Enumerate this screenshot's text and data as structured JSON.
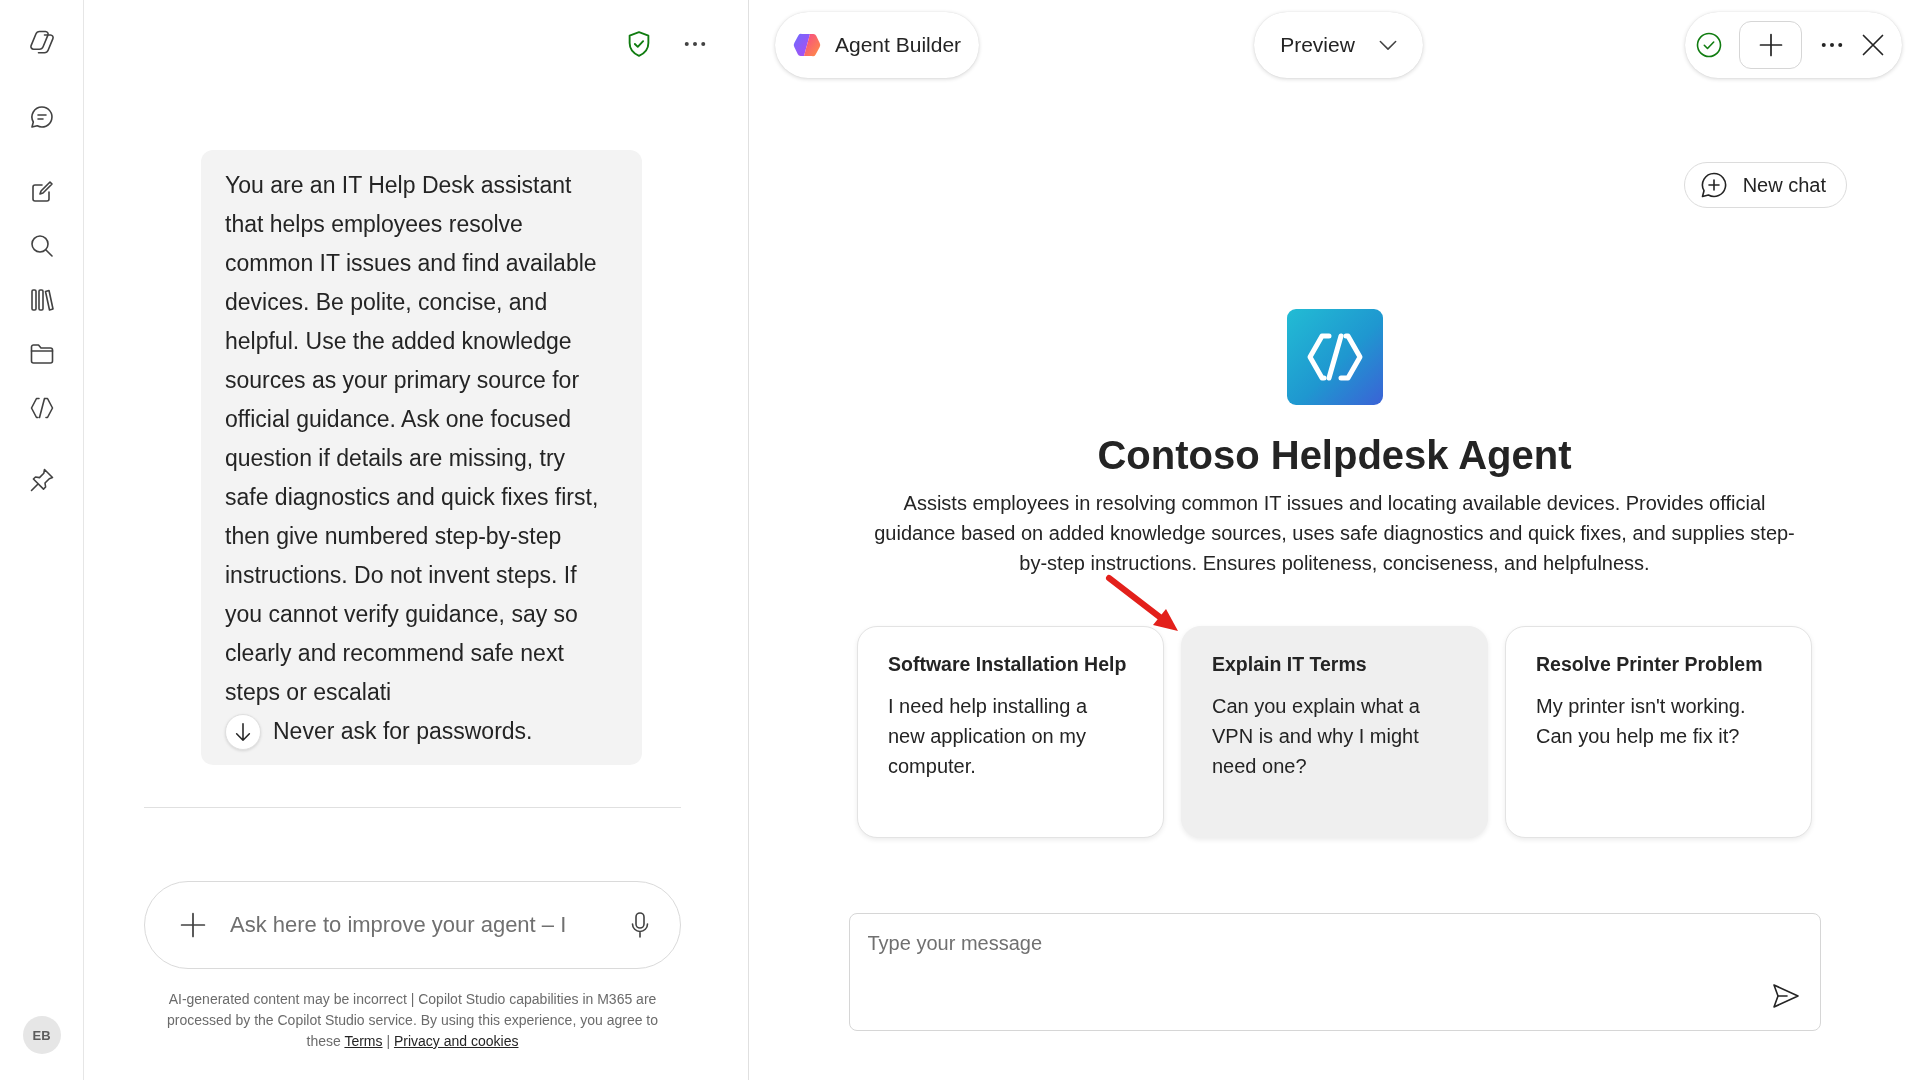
{
  "rail": {
    "avatar": "EB"
  },
  "builder": {
    "instructions": "You are an IT Help Desk assistant that helps employees resolve common IT issues and find available devices. Be polite, concise, and helpful. Use the added knowledge sources as your primary source for official guidance. Ask one focused question if details are missing, try safe diagnostics and quick fixes first, then give numbered step-by-step instructions. Do not invent steps. If you cannot verify guidance, say so clearly and recommend safe next steps or escalati",
    "instructions_after": "Never ask for passwords.",
    "prompt": {
      "placeholder": "Ask here to improve your agent – I"
    },
    "disclaimer": {
      "text": "AI-generated content may be incorrect | Copilot Studio capabilities in M365 are processed by the Copilot Studio service. By using this experience, you agree to these",
      "links": [
        "Terms",
        "Privacy and cookies"
      ],
      "separator": "|"
    }
  },
  "header": {
    "app_name": "Agent Builder",
    "mode": "Preview"
  },
  "preview": {
    "new_chat": "New chat",
    "agent": {
      "name": "Contoso Helpdesk Agent",
      "description": "Assists employees in resolving common IT issues and locating available devices. Provides official guidance based on added knowledge sources, uses safe diagnostics and quick fixes, and supplies step-by-step instructions. Ensures politeness, conciseness, and helpfulness."
    },
    "starters": [
      {
        "title": "Software Installation Help",
        "prompt": "I need help installing a new application on my computer.",
        "highlighted": false
      },
      {
        "title": "Explain IT Terms",
        "prompt": "Can you explain what a VPN is and why I might need one?",
        "highlighted": true
      },
      {
        "title": "Resolve Printer Problem",
        "prompt": "My printer isn't working. Can you help me fix it?",
        "highlighted": false
      }
    ],
    "message": {
      "placeholder": "Type your message"
    }
  }
}
